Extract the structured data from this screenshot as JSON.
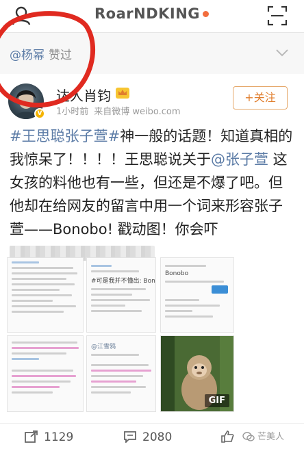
{
  "header": {
    "title": "RoarNDKING",
    "profile_icon": "person-icon",
    "scan_icon": "scan-icon",
    "dot_color": "#f26d3d"
  },
  "like_notice": {
    "user": "@杨幂",
    "verb": "赞过"
  },
  "author": {
    "name": "达人肖钧",
    "time": "1小时前",
    "source": "来自微博 weibo.com",
    "follow_label": "+关注"
  },
  "post": {
    "part1": "#王思聪张子萱#",
    "part2": "神一般的话题！知道真相的我惊呆了！！！！王思聪说关于",
    "part3": "@张子萱",
    "part4": " 这女孩的料他也有一些，但还是不爆了吧。但他却在给网友的留言中用一个词来形容张子萱——Bonobo! 戳动图！你会",
    "part5": "吓"
  },
  "thumbnails": {
    "c2_label": "#可是我并不懂出: Bonobo",
    "c3_label": "Bonobo",
    "c5_label": "@江雪鸦",
    "gif_label": "GIF"
  },
  "actions": {
    "repost_count": "1129",
    "comment_count": "2080"
  },
  "brand": {
    "label": "芒美人"
  },
  "colors": {
    "link": "#5b7ba6",
    "follow": "#e07d2c",
    "annotation": "#e02a20"
  }
}
